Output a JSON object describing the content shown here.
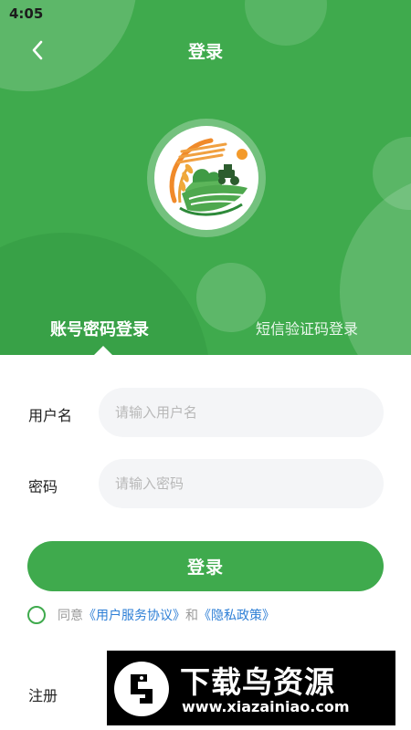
{
  "status_bar": {
    "time": "4:05"
  },
  "header": {
    "title": "登录"
  },
  "tabs": {
    "account": "账号密码登录",
    "sms": "短信验证码登录"
  },
  "form": {
    "username_label": "用户名",
    "username_placeholder": "请输入用户名",
    "password_label": "密码",
    "password_placeholder": "请输入密码"
  },
  "login_button": "登录",
  "agreement": {
    "prefix": "同意",
    "terms_link": "《用户服务协议》",
    "and": "和",
    "privacy_link": "《隐私政策》"
  },
  "register_label": "注册",
  "watermark": {
    "title": "下载鸟资源",
    "url": "www.xiazainiao.com"
  },
  "colors": {
    "primary": "#3faa4d",
    "link": "#2e7fd6",
    "field_bg": "#f4f5f7"
  }
}
